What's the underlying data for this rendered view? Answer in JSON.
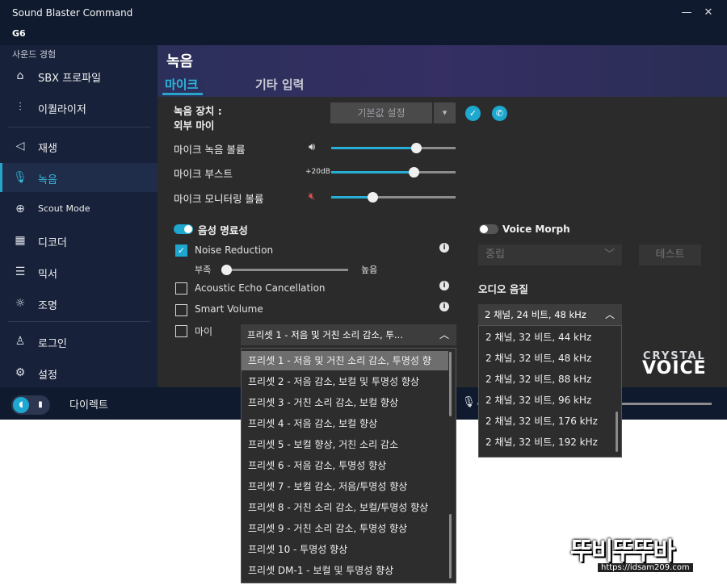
{
  "app": {
    "title": "Sound Blaster Command",
    "device": "G6"
  },
  "window": {
    "minimize": "—",
    "close": "✕"
  },
  "sidebar": {
    "heading": "사운드 경험",
    "items": [
      {
        "label": "SBX 프로파일",
        "icon": "home-icon"
      },
      {
        "label": "이퀄라이저",
        "icon": "equalizer-icon"
      },
      {
        "label": "재생",
        "icon": "speaker-icon"
      },
      {
        "label": "녹음",
        "icon": "microphone-icon"
      },
      {
        "label": "Scout Mode",
        "icon": "crosshair-icon"
      },
      {
        "label": "디코더",
        "icon": "decoder-icon"
      },
      {
        "label": "믹서",
        "icon": "mixer-icon"
      },
      {
        "label": "조명",
        "icon": "lightbulb-icon"
      },
      {
        "label": "로그인",
        "icon": "user-icon"
      },
      {
        "label": "설정",
        "icon": "gear-icon"
      }
    ]
  },
  "main": {
    "title": "녹음",
    "tabs": [
      {
        "label": "마이크",
        "active": true
      },
      {
        "label": "기타 입력",
        "active": false
      }
    ],
    "device_label_1": "녹음 장치 :",
    "device_label_2": "외부 마이",
    "default_button": "기본값 설정",
    "mic_volume": {
      "label": "마이크 녹음 볼륨",
      "value": 0.68
    },
    "mic_boost": {
      "label": "마이크 부스트",
      "value_text": "+20dB",
      "value": 0.66
    },
    "mic_monitor": {
      "label": "마이크 모니터링 볼륨",
      "value": 0.33
    },
    "voice_clarity": {
      "label": "음성 명료성",
      "on": true
    },
    "noise_reduction": {
      "label": "Noise Reduction",
      "checked": true,
      "min_label": "부족",
      "max_label": "높음",
      "value": 0.0
    },
    "echo_cancel": {
      "label": "Acoustic Echo Cancellation",
      "checked": false
    },
    "smart_volume": {
      "label": "Smart Volume",
      "checked": false
    },
    "mic_eq": {
      "label": "마이",
      "checked": false
    },
    "preset_selected": "프리셋 1 - 저음 및 거친 소리 감소, 투...",
    "voice_morph": {
      "label": "Voice Morph",
      "on": false,
      "selected": "중립",
      "test_button": "테스트"
    },
    "audio_quality": {
      "label": "오디오 음질",
      "selected": "2 채널, 24 비트, 48 kHz"
    }
  },
  "preset_list": [
    "프리셋 1 - 저음 및 거친 소리 감소, 투명성 향",
    "프리셋 2 - 저음 감소, 보컬 및 투명성 향상",
    "프리셋 3 - 거친 소리 감소, 보컬 향상",
    "프리셋 4 - 저음 감소, 보컬 향상",
    "프리셋 5 - 보컬 향상, 거친 소리 감소",
    "프리셋 6 - 저음 감소, 투명성 향상",
    "프리셋 7 - 보컬 감소, 저음/투명성 향상",
    "프리셋 8 - 거친 소리 감소, 보컬/투명성 향상",
    "프리셋 9 - 거친 소리 감소, 투명성 향상",
    "프리셋 10 - 투명성 향상",
    "프리셋 DM-1 - 보컬 및 투명성 향상"
  ],
  "quality_list": [
    "2 채널, 32 비트, 44 kHz",
    "2 채널, 32 비트, 48 kHz",
    "2 채널, 32 비트, 88 kHz",
    "2 채널, 32 비트, 96 kHz",
    "2 채널, 32 비트, 176 kHz",
    "2 채널, 32 비트, 192 kHz"
  ],
  "logo": {
    "line1": "CRYSTAL",
    "line2": "VOICE"
  },
  "footer": {
    "mode_label": "다이렉트",
    "mic_volume": 0.44
  },
  "watermark": {
    "main": "뚜비뚜뚜바",
    "url": "https://idsam209.com"
  }
}
